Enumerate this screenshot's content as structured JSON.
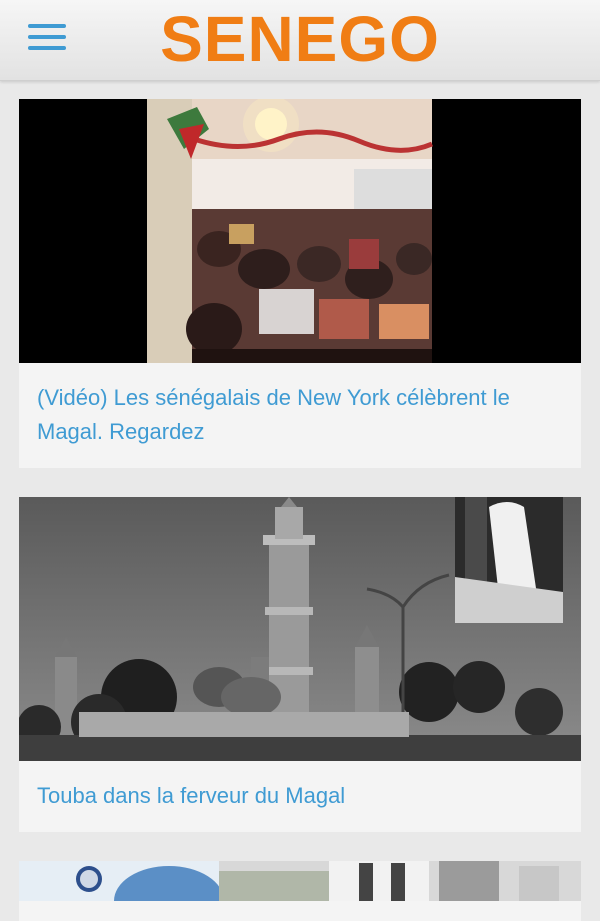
{
  "app": {
    "logo_text": "SENEGO",
    "brand_color": "#f07d14",
    "accent_color": "#3f9bd3"
  },
  "header": {
    "menu_icon": "hamburger-menu-icon"
  },
  "articles": [
    {
      "title": "(Vidéo) Les sénégalais de New York célèbrent le Magal. Regardez",
      "image": "crowd-in-hall-photo"
    },
    {
      "title": "Touba dans la ferveur du Magal",
      "image": "touba-mosque-photo"
    },
    {
      "title": "",
      "image": "mosque-courtyard-photo"
    }
  ]
}
